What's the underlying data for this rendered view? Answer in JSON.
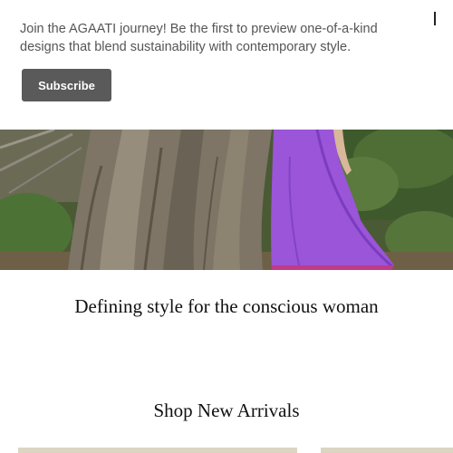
{
  "popup": {
    "message": "Join the AGAATI journey! Be the first to preview one-of-a-kind designs that blend sustainability with contemporary style.",
    "subscribe_label": "Subscribe",
    "close_icon": "close-icon"
  },
  "hero": {
    "image": "woman-in-purple-dress-beside-tree"
  },
  "tagline": "Defining style for the conscious woman",
  "arrivals": {
    "title": "Shop New Arrivals"
  },
  "colors": {
    "button": "#5a5a5a",
    "dress": "#9a55d8",
    "card": "#dcd5c2"
  }
}
